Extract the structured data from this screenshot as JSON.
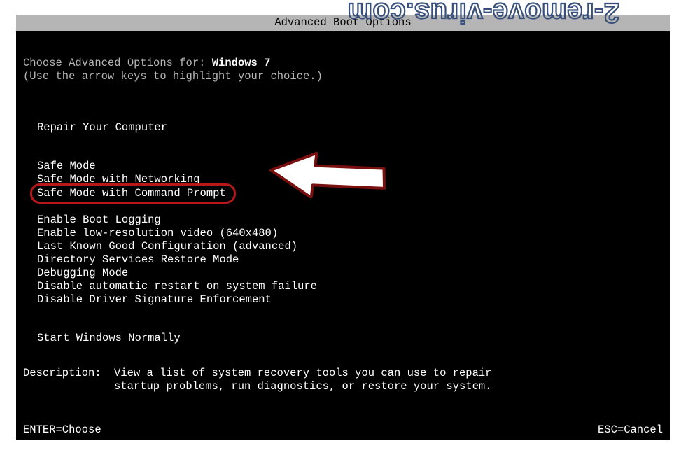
{
  "watermark": "2-remove-virus.com",
  "title": "Advanced Boot Options",
  "prompt_prefix": "Choose Advanced Options for: ",
  "os_name": "Windows 7",
  "hint": "(Use the arrow keys to highlight your choice.)",
  "groups": {
    "repair": [
      "Repair Your Computer"
    ],
    "safemodes": [
      "Safe Mode",
      "Safe Mode with Networking",
      "Safe Mode with Command Prompt"
    ],
    "advanced": [
      "Enable Boot Logging",
      "Enable low-resolution video (640x480)",
      "Last Known Good Configuration (advanced)",
      "Directory Services Restore Mode",
      "Debugging Mode",
      "Disable automatic restart on system failure",
      "Disable Driver Signature Enforcement"
    ],
    "normal": [
      "Start Windows Normally"
    ]
  },
  "highlighted_index": 2,
  "description_label": "Description:",
  "description_text": "View a list of system recovery tools you can use to repair\nstartup problems, run diagnostics, or restore your system.",
  "footer": {
    "enter": "ENTER=Choose",
    "esc": "ESC=Cancel"
  }
}
